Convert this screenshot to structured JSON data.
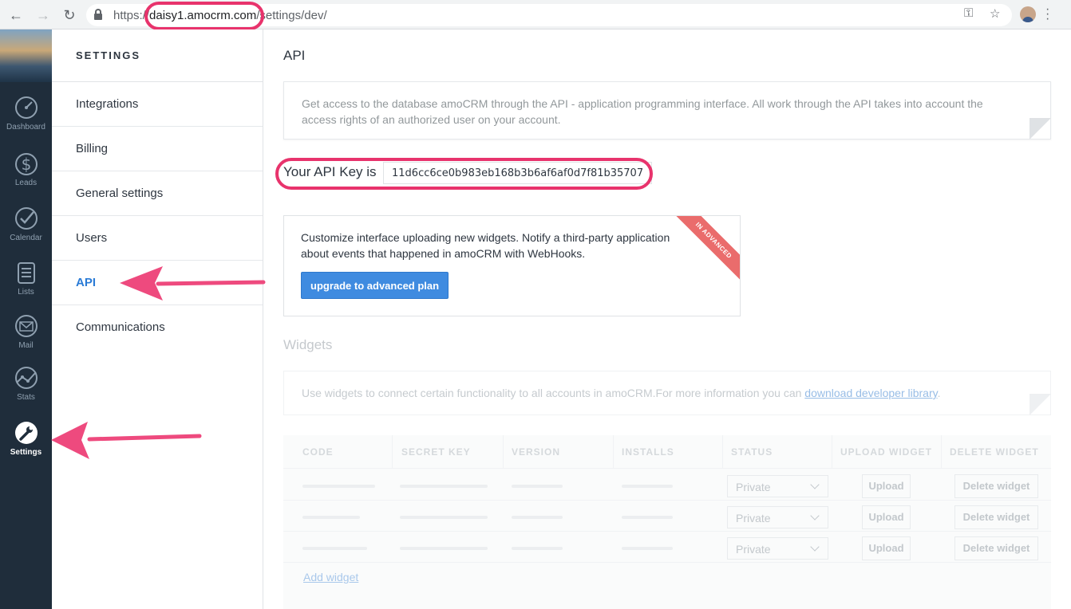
{
  "browser": {
    "url_scheme": "https://",
    "url_host": "daisy1.amocrm.com",
    "url_path": "/settings/dev/"
  },
  "leftbar": {
    "items": [
      {
        "label": "Dashboard",
        "icon": "dashboard-icon"
      },
      {
        "label": "Leads",
        "icon": "dollar-icon"
      },
      {
        "label": "Calendar",
        "icon": "check-circle-icon"
      },
      {
        "label": "Lists",
        "icon": "list-icon"
      },
      {
        "label": "Mail",
        "icon": "mail-icon"
      },
      {
        "label": "Stats",
        "icon": "stats-icon"
      },
      {
        "label": "Settings",
        "icon": "wrench-icon",
        "active": true
      }
    ]
  },
  "settings_nav": {
    "title": "SETTINGS",
    "items": [
      {
        "label": "Integrations"
      },
      {
        "label": "Billing"
      },
      {
        "label": "General settings"
      },
      {
        "label": "Users"
      },
      {
        "label": "API",
        "active": true
      },
      {
        "label": "Communications"
      }
    ]
  },
  "main": {
    "title": "API",
    "info": "Get access to the database amoCRM through the API - application programming interface. All work through the API takes into account the access rights of an authorized user on your account.",
    "api_key_label": "Your API Key is",
    "api_key_value": "11d6cc6ce0b983eb168b3b6af6af0d7f81b35707",
    "upgrade_text": "Customize interface uploading new widgets. Notify a third-party application about events that happened in amoCRM with WebHooks.",
    "upgrade_button": "upgrade to advanced plan",
    "ribbon": "IN ADVANCED",
    "widgets_title": "Widgets",
    "widgets_info_prefix": "Use widgets to connect certain functionality to all accounts in amoCRM.For more information you can ",
    "widgets_info_link": "download developer library",
    "widgets_info_suffix": ".",
    "table": {
      "columns": [
        "CODE",
        "SECRET KEY",
        "VERSION",
        "INSTALLS",
        "STATUS",
        "UPLOAD WIDGET",
        "DELETE WIDGET"
      ],
      "rows": [
        {
          "status": "Private",
          "upload": "Upload",
          "delete": "Delete widget"
        },
        {
          "status": "Private",
          "upload": "Upload",
          "delete": "Delete widget"
        },
        {
          "status": "Private",
          "upload": "Upload",
          "delete": "Delete widget"
        }
      ]
    },
    "add_widget": "Add widget"
  },
  "colors": {
    "highlight": "#e8336c",
    "accent": "#2a7bd6",
    "sidebar_bg": "#1f2d3b",
    "button_blue": "#3f8be0",
    "ribbon": "#ea6c6c"
  }
}
